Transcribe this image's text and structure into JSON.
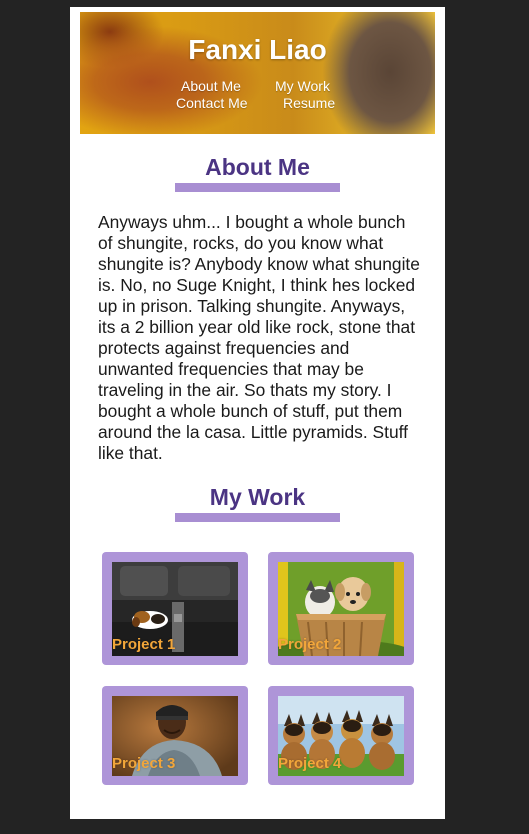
{
  "header": {
    "title": "Fanxi Liao",
    "nav": {
      "about": "About Me",
      "work": "My Work",
      "contact": "Contact Me",
      "resume": "Resume"
    }
  },
  "about": {
    "heading": "About Me",
    "text": "Anyways uhm... I bought a whole bunch of shungite, rocks, do you know what shungite is? Anybody know what shungite is. No, no Suge Knight, I think hes locked up in prison. Talking shungite. Anyways, its a 2 billion year old like rock, stone that protects against frequencies and unwanted frequencies that may be traveling in the air. So thats my story. I bought a whole bunch of stuff, put them around the la casa. Little pyramids. Stuff like that."
  },
  "work": {
    "heading": "My Work",
    "projects": [
      {
        "label": "Project 1"
      },
      {
        "label": "Project 2"
      },
      {
        "label": "Project 3"
      },
      {
        "label": "Project 4"
      }
    ]
  },
  "colors": {
    "background": "#232323",
    "page": "#ffffff",
    "heading": "#4b3483",
    "accent": "#a88ed2",
    "card": "#ae95d8",
    "project_label": "#f2a63a"
  }
}
